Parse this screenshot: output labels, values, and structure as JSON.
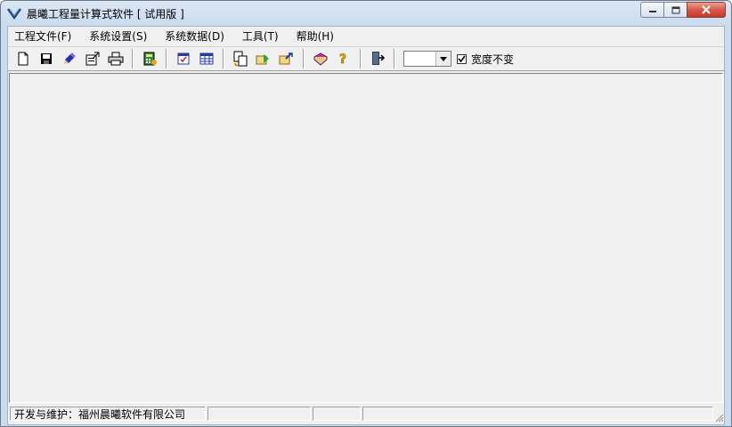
{
  "window": {
    "title": "晨曦工程量计算式软件 [ 试用版 ]"
  },
  "menu": [
    {
      "id": "project-file",
      "label": "工程文件(F)"
    },
    {
      "id": "system-settings",
      "label": "系统设置(S)"
    },
    {
      "id": "system-data",
      "label": "系统数据(D)"
    },
    {
      "id": "tools",
      "label": "工具(T)"
    },
    {
      "id": "help",
      "label": "帮助(H)"
    }
  ],
  "toolbar": {
    "width_select_value": "",
    "keep_width_checked": true,
    "keep_width_label": "宽度不变",
    "icons": [
      "new-file-icon",
      "save-icon",
      "edit-icon",
      "properties-icon",
      "print-icon",
      "calculator-icon",
      "checklist-icon",
      "table-icon",
      "copy-icon",
      "export-icon",
      "import-icon",
      "book-icon",
      "help-icon",
      "exit-icon"
    ]
  },
  "status": {
    "developer": "开发与维护：福州晨曦软件有限公司",
    "panel2": "",
    "panel3": "",
    "panel4": ""
  },
  "colors": {
    "accent_close": "#c33b2b",
    "client_bg": "#f0f0f0"
  }
}
